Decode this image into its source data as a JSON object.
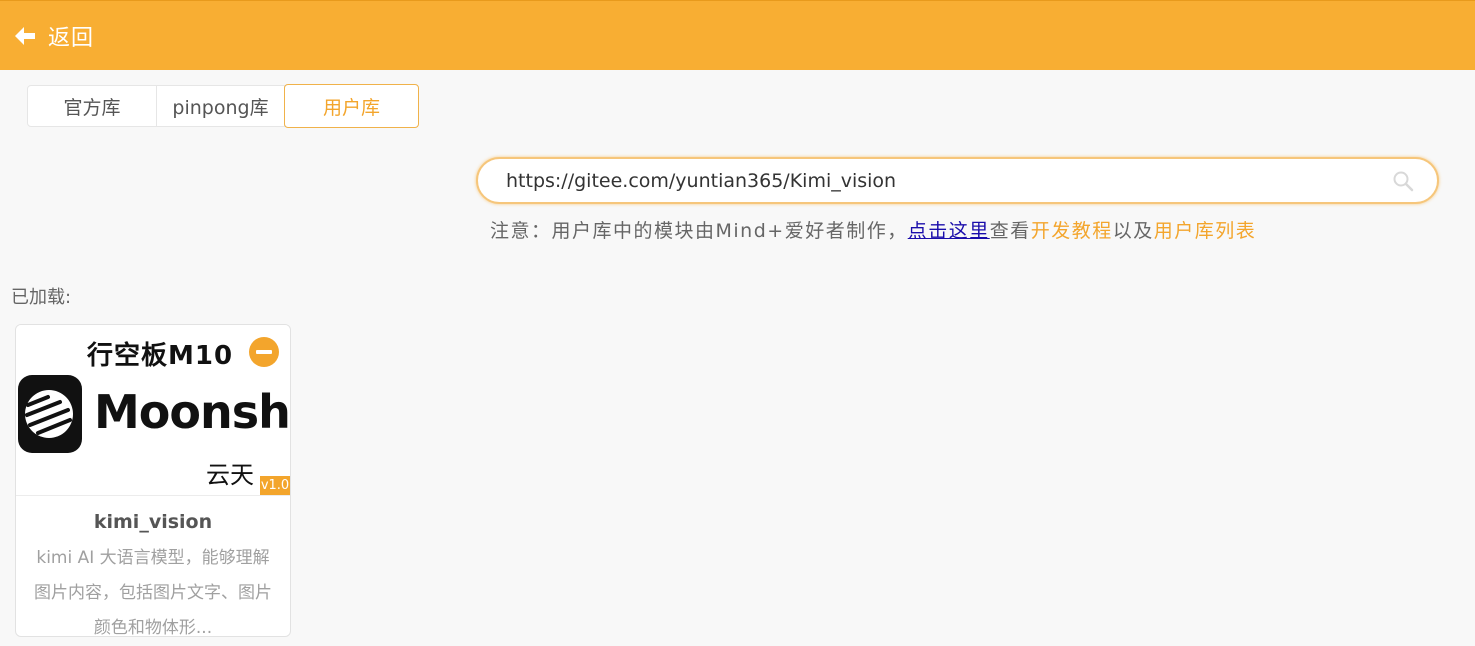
{
  "header": {
    "back_label": "返回",
    "bg_color": "#f8ae33"
  },
  "tabs": [
    {
      "label": "官方库",
      "active": false
    },
    {
      "label": "pinpong库",
      "active": false
    },
    {
      "label": "用户库",
      "active": true
    }
  ],
  "search": {
    "value": "https://gitee.com/yuntian365/Kimi_vision",
    "icon": "search-icon"
  },
  "notice": {
    "prefix": "注意：用户库中的模块由Mind+爱好者制作，",
    "link_here": "点击这里",
    "middle": "查看",
    "link_tutorial": "开发教程",
    "and": "以及",
    "link_list": "用户库列表"
  },
  "loaded_label": "已加载:",
  "extensions": [
    {
      "cover_title": "行空板M10",
      "cover_brand": "Moonshot",
      "cover_author": "云天",
      "version": "v1.0",
      "name": "kimi_vision",
      "description": "kimi AI 大语言模型，能够理解图片内容，包括图片文字、图片颜色和物体形...",
      "action_icon": "remove-icon"
    }
  ],
  "colors": {
    "accent": "#f3a52c",
    "link": "#1a0dab"
  }
}
